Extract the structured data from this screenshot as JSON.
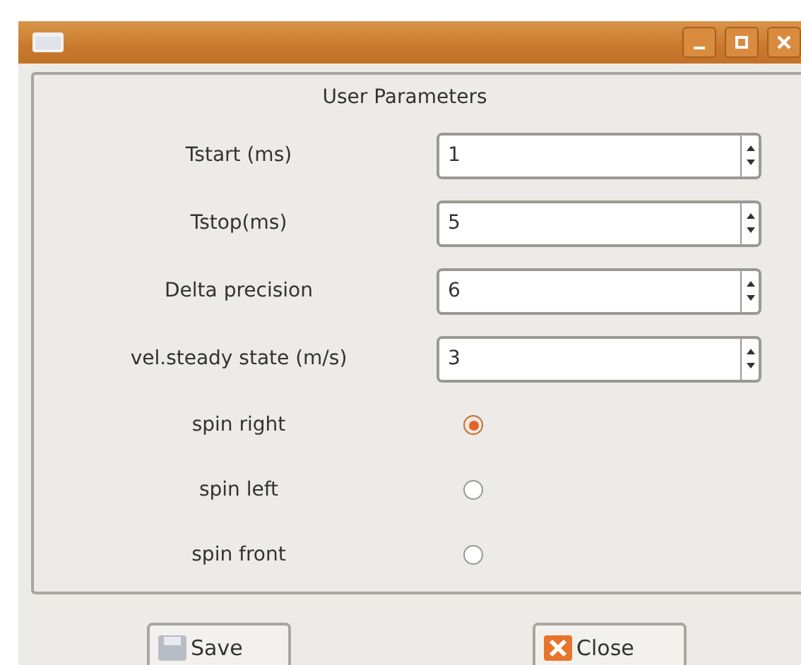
{
  "group": {
    "title": "User Parameters"
  },
  "fields": [
    {
      "label": "Tstart (ms)",
      "value": "1"
    },
    {
      "label": "Tstop(ms)",
      "value": "5"
    },
    {
      "label": "Delta precision",
      "value": "6"
    },
    {
      "label": "vel.steady state (m/s)",
      "value": "3"
    }
  ],
  "options": [
    {
      "label": "spin right",
      "selected": true
    },
    {
      "label": "spin left",
      "selected": false
    },
    {
      "label": "spin front",
      "selected": false
    }
  ],
  "buttons": [
    {
      "kind": "save",
      "label": "Save"
    },
    {
      "kind": "close",
      "label": "Close"
    }
  ]
}
